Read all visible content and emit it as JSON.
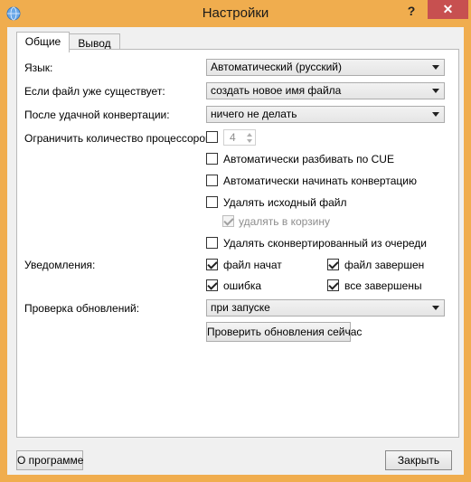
{
  "window": {
    "title": "Настройки",
    "help_glyph": "?",
    "close_glyph": "✕",
    "title_bar_color": "#f0ad4e",
    "close_color": "#c75050"
  },
  "tabs": [
    {
      "label": "Общие",
      "active": true
    },
    {
      "label": "Вывод",
      "active": false
    }
  ],
  "general": {
    "language_label": "Язык:",
    "language_value": "Автоматический (русский)",
    "file_exists_label": "Если файл уже существует:",
    "file_exists_value": "создать новое имя файла",
    "after_conv_label": "После удачной конвертации:",
    "after_conv_value": "ничего не делать",
    "limit_cpu_label": "Ограничить количество процессоров:",
    "limit_cpu_value": "4",
    "split_cue_label": "Автоматически разбивать по CUE",
    "auto_start_label": "Автоматически начинать конвертацию",
    "delete_source_label": "Удалять исходный файл",
    "to_recycle_label": "удалять в корзину",
    "remove_converted_label": "Удалять сконвертированный из очереди",
    "notifications_label": "Уведомления:",
    "notify_started": "файл начат",
    "notify_finished": "файл завершен",
    "notify_error": "ошибка",
    "notify_all_done": "все завершены",
    "check_updates_label": "Проверка обновлений:",
    "check_updates_value": "при запуске",
    "check_now_button": "Проверить обновления сейчас"
  },
  "footer": {
    "about_button": "О программе",
    "close_button": "Закрыть"
  }
}
